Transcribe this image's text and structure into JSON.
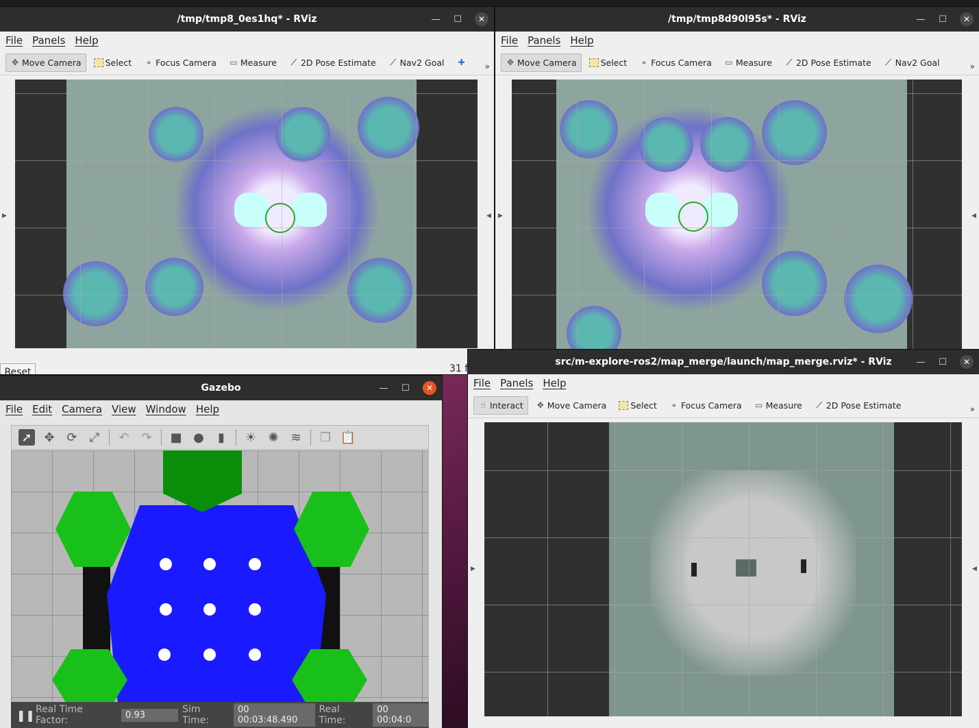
{
  "rviz_left": {
    "title": "/tmp/tmp8_0es1hq* - RViz",
    "menu": [
      "File",
      "Panels",
      "Help"
    ],
    "tools": [
      {
        "label": "Move Camera",
        "icon": "move-camera-icon"
      },
      {
        "label": "Select",
        "icon": "select-icon"
      },
      {
        "label": "Focus Camera",
        "icon": "focus-camera-icon"
      },
      {
        "label": "Measure",
        "icon": "measure-icon"
      },
      {
        "label": "2D Pose Estimate",
        "icon": "pose-estimate-icon"
      },
      {
        "label": "Nav2 Goal",
        "icon": "nav2-goal-icon"
      }
    ],
    "reset_label": "Reset",
    "fps_text": "31 f"
  },
  "rviz_right": {
    "title": "/tmp/tmp8d90l95s* - RViz",
    "menu": [
      "File",
      "Panels",
      "Help"
    ],
    "tools": [
      {
        "label": "Move Camera",
        "icon": "move-camera-icon"
      },
      {
        "label": "Select",
        "icon": "select-icon"
      },
      {
        "label": "Focus Camera",
        "icon": "focus-camera-icon"
      },
      {
        "label": "Measure",
        "icon": "measure-icon"
      },
      {
        "label": "2D Pose Estimate",
        "icon": "pose-estimate-icon"
      },
      {
        "label": "Nav2 Goal",
        "icon": "nav2-goal-icon"
      }
    ]
  },
  "rviz_merge": {
    "title": "src/m-explore-ros2/map_merge/launch/map_merge.rviz* - RViz",
    "menu": [
      "File",
      "Panels",
      "Help"
    ],
    "tools": [
      {
        "label": "Interact",
        "icon": "interact-icon"
      },
      {
        "label": "Move Camera",
        "icon": "move-camera-icon"
      },
      {
        "label": "Select",
        "icon": "select-icon"
      },
      {
        "label": "Focus Camera",
        "icon": "focus-camera-icon"
      },
      {
        "label": "Measure",
        "icon": "measure-icon"
      },
      {
        "label": "2D Pose Estimate",
        "icon": "pose-estimate-icon"
      }
    ]
  },
  "gazebo": {
    "title": "Gazebo",
    "menu": [
      "File",
      "Edit",
      "Camera",
      "View",
      "Window",
      "Help"
    ],
    "real_time_factor_label": "Real Time Factor:",
    "real_time_factor_value": "0.93",
    "sim_time_label": "Sim Time:",
    "sim_time_value": "00 00:03:48.490",
    "real_time_label": "Real Time:",
    "real_time_value": "00 00:04:0"
  },
  "colors": {
    "title_bar": "#2d2d2d",
    "close_active": "#e95420",
    "costmap_teal": "#5ab8b0",
    "costmap_blue": "#6f72c8",
    "map_free": "#c8c8c8",
    "map_unknown": "#7f9690",
    "scan_blue": "#1a1aff"
  }
}
